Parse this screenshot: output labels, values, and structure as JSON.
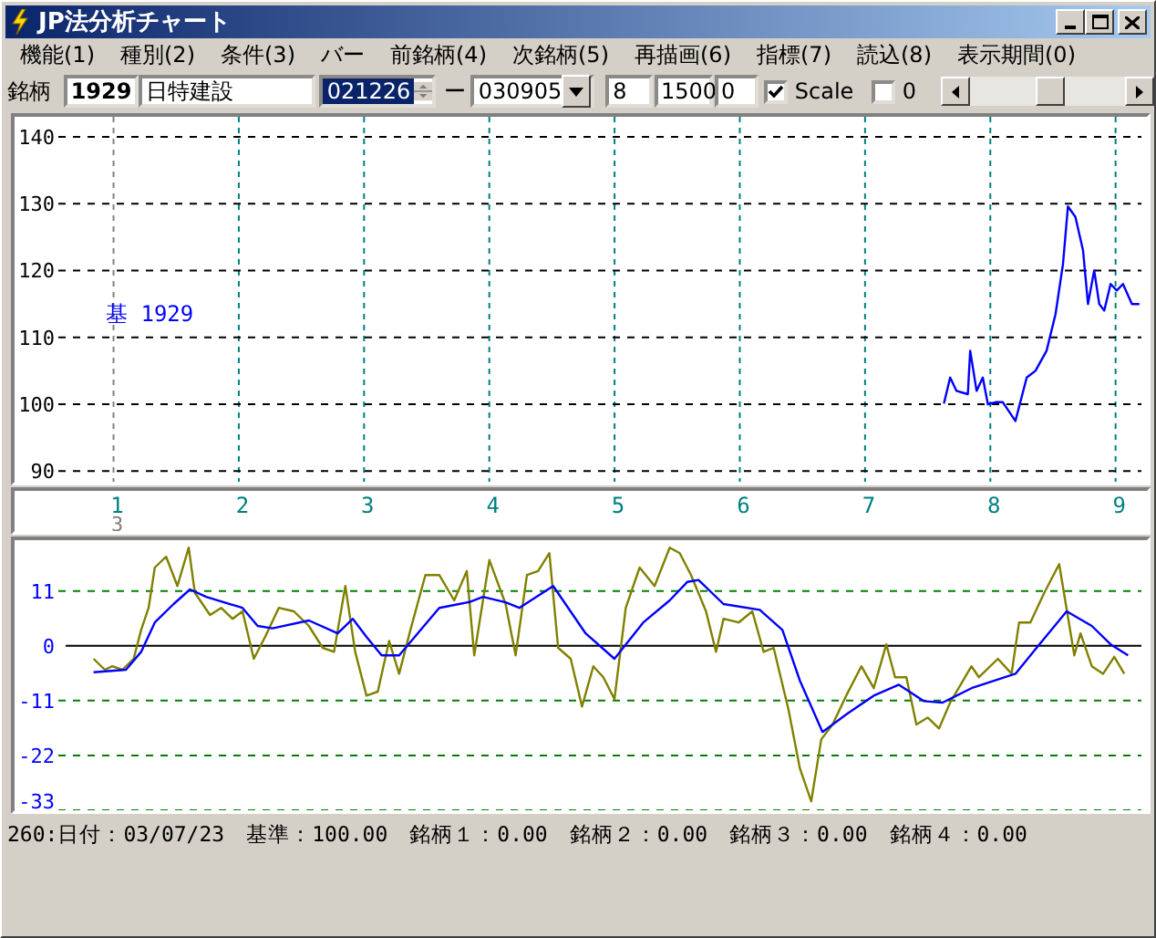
{
  "window": {
    "title": "JP法分析チャート"
  },
  "menu": [
    "機能(1)",
    "種別(2)",
    "条件(3)",
    "バー",
    "前銘柄(4)",
    "次銘柄(5)",
    "再描画(6)",
    "指標(7)",
    "読込(8)",
    "表示期間(0)"
  ],
  "toolbar": {
    "label": "銘柄",
    "code": "1929",
    "name": "日特建設",
    "start_date": {
      "value": "021226",
      "selected": true
    },
    "separator": "ー",
    "end_date": "030905",
    "fields": [
      "8",
      "1500",
      "0"
    ],
    "checkboxes": [
      {
        "label": "Scale",
        "checked": true
      },
      {
        "label": "0",
        "checked": false
      }
    ]
  },
  "upper_chart": {
    "chart_data": {
      "type": "line",
      "grid": true,
      "xlim": [
        0.21,
        9.25
      ],
      "ylim": [
        88.4,
        143
      ],
      "xticks": [
        {
          "value": 1,
          "label": "1"
        },
        {
          "value": 2,
          "label": "2"
        },
        {
          "value": 3,
          "label": "3"
        },
        {
          "value": 4,
          "label": "4"
        },
        {
          "value": 5,
          "label": "5"
        },
        {
          "value": 6,
          "label": "6"
        },
        {
          "value": 7,
          "label": "7"
        },
        {
          "value": 8,
          "label": "8"
        },
        {
          "value": 9,
          "label": "9"
        }
      ],
      "yticks": [
        {
          "value": 90,
          "label": "90"
        },
        {
          "value": 100,
          "label": "100"
        },
        {
          "value": 110,
          "label": "110"
        },
        {
          "value": 120,
          "label": "120"
        },
        {
          "value": 130,
          "label": "130"
        },
        {
          "value": 140,
          "label": "140"
        }
      ],
      "x": [
        7.63,
        7.68,
        7.73,
        7.82,
        7.84,
        7.89,
        7.94,
        7.98,
        8.04,
        8.1,
        8.2,
        8.29,
        8.36,
        8.45,
        8.52,
        8.58,
        8.62,
        8.68,
        8.74,
        8.78,
        8.83,
        8.87,
        8.91,
        8.96,
        9.01,
        9.06,
        9.13,
        9.19
      ],
      "series": [
        {
          "name": "基 1929",
          "color": "#0000ff",
          "values": [
            100.1,
            104,
            102,
            101.5,
            108,
            102,
            104,
            100,
            100.3,
            100.3,
            97.5,
            104,
            105,
            108,
            113.5,
            121,
            129.6,
            128,
            123,
            115,
            120,
            115,
            114,
            118,
            117,
            118,
            115,
            115
          ]
        }
      ],
      "ref_lines": [
        {
          "axis": "x",
          "value": 1,
          "color": "#808080"
        }
      ]
    },
    "year_label": "3"
  },
  "lower_chart": {
    "chart_data": {
      "type": "line",
      "grid": true,
      "xlim": [
        0.21,
        9.25
      ],
      "ylim": [
        -33,
        21.2
      ],
      "yticks": [
        {
          "value": 11,
          "label": "11"
        },
        {
          "value": 0,
          "label": "0"
        },
        {
          "value": -11,
          "label": "-11"
        },
        {
          "value": -22,
          "label": "-22"
        },
        {
          "value": -33,
          "label": "-33"
        }
      ],
      "series": [
        {
          "color": "#808000",
          "x": [
            0.84,
            0.93,
            0.99,
            1.07,
            1.16,
            1.22,
            1.28,
            1.33,
            1.42,
            1.51,
            1.6,
            1.65,
            1.77,
            1.86,
            1.95,
            2.03,
            2.12,
            2.21,
            2.32,
            2.44,
            2.56,
            2.67,
            2.76,
            2.85,
            2.93,
            3.02,
            3.11,
            3.2,
            3.28,
            3.37,
            3.49,
            3.6,
            3.72,
            3.82,
            3.88,
            4,
            4.13,
            4.21,
            4.3,
            4.39,
            4.48,
            4.55,
            4.65,
            4.74,
            4.83,
            4.91,
            5,
            5.09,
            5.2,
            5.32,
            5.44,
            5.52,
            5.61,
            5.73,
            5.81,
            5.87,
            5.99,
            6.1,
            6.19,
            6.27,
            6.39,
            6.48,
            6.57,
            6.65,
            6.74,
            6.85,
            6.97,
            7.07,
            7.17,
            7.24,
            7.33,
            7.41,
            7.5,
            7.59,
            7.68,
            7.85,
            7.91,
            8.06,
            8.17,
            8.23,
            8.32,
            8.43,
            8.55,
            8.67,
            8.72,
            8.81,
            8.9,
            8.99,
            9.07
          ],
          "values": [
            -2.6,
            -4.8,
            -4.1,
            -4.8,
            -2.6,
            3.2,
            7.6,
            15.7,
            17.9,
            12,
            19.7,
            10.6,
            6.2,
            7.6,
            5.4,
            6.9,
            -2.6,
            1.8,
            7.6,
            6.9,
            4,
            -0.4,
            -1.2,
            12,
            -1.2,
            -10,
            -9.2,
            1,
            -5.6,
            3.2,
            14.2,
            14.2,
            9.1,
            15,
            -1.9,
            17.2,
            8.4,
            -1.9,
            14.2,
            15,
            18.6,
            -0.4,
            -2.6,
            -12.2,
            -4.1,
            -6.3,
            -10.7,
            7.6,
            15.7,
            12,
            19.7,
            18.6,
            14.2,
            6.9,
            -1.2,
            5.4,
            4.7,
            6.9,
            -1.2,
            -0.4,
            -12.9,
            -24.6,
            -31.2,
            -18.8,
            -15.8,
            -10,
            -4.1,
            -8.5,
            0.3,
            -6.3,
            -6.3,
            -15.8,
            -14.4,
            -16.6,
            -11.4,
            -4.1,
            -6.3,
            -2.6,
            -5.6,
            4.7,
            4.7,
            10.6,
            16.4,
            -1.9,
            2.5,
            -4.1,
            -5.6,
            -2.2,
            -5.6
          ]
        },
        {
          "color": "#0000ff",
          "x": [
            0.84,
            1.1,
            1.22,
            1.33,
            1.48,
            1.61,
            1.74,
            2.03,
            2.15,
            2.27,
            2.56,
            2.79,
            2.91,
            3.02,
            3.14,
            3.28,
            3.6,
            3.84,
            3.95,
            4.13,
            4.24,
            4.51,
            4.77,
            5,
            5.23,
            5.44,
            5.58,
            5.67,
            5.87,
            6.16,
            6.34,
            6.48,
            6.66,
            6.86,
            7.07,
            7.27,
            7.47,
            7.62,
            7.85,
            8.2,
            8.37,
            8.61,
            8.81,
            8.96,
            9.1
          ],
          "values": [
            -5.3,
            -4.8,
            -1.2,
            4.7,
            8.4,
            11.3,
            9.8,
            7.6,
            4,
            3.5,
            5.1,
            2.5,
            5.4,
            1.8,
            -1.9,
            -1.9,
            7.6,
            8.8,
            9.8,
            8.7,
            7.6,
            12,
            2.5,
            -2.6,
            4.7,
            9.1,
            12.8,
            13.2,
            8.4,
            7.2,
            3.2,
            -7,
            -17.3,
            -13.6,
            -10,
            -7.8,
            -11.1,
            -11.4,
            -8.5,
            -5.6,
            -0.4,
            6.9,
            4,
            0.3,
            -1.9
          ]
        }
      ]
    }
  },
  "status_bar": {
    "items": [
      "260:日付：03/07/23",
      "基準：100.00",
      "銘柄１：0.00",
      "銘柄２：0.00",
      "銘柄３：0.00",
      "銘柄４：0.00"
    ]
  }
}
